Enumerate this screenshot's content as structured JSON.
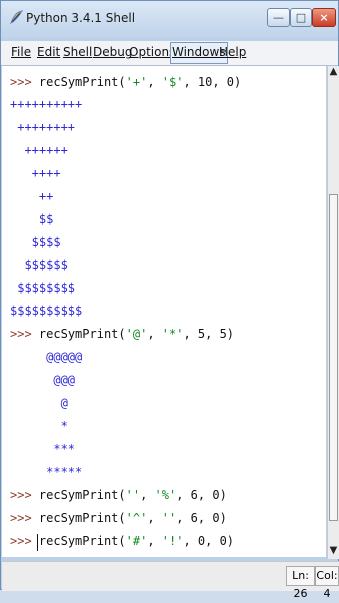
{
  "window": {
    "title": "Python 3.4.1 Shell",
    "buttons": {
      "minimize": "—",
      "maximize": "□",
      "close": "×"
    }
  },
  "menu": [
    "File",
    "Edit",
    "Shell",
    "Debug",
    "Options",
    "Windows",
    "Help"
  ],
  "shell": {
    "prompt": ">>>",
    "lines": [
      {
        "type": "command",
        "prompt": ">>>",
        "code": "recSymPrint('+', '$', 10, 0)"
      },
      {
        "type": "output",
        "text": "++++++++++"
      },
      {
        "type": "output",
        "text": " ++++++++"
      },
      {
        "type": "output",
        "text": "  ++++++"
      },
      {
        "type": "output",
        "text": "   ++++"
      },
      {
        "type": "output",
        "text": "    ++"
      },
      {
        "type": "output",
        "text": "    $$"
      },
      {
        "type": "output",
        "text": "   $$$$"
      },
      {
        "type": "output",
        "text": "  $$$$$$"
      },
      {
        "type": "output",
        "text": " $$$$$$$$"
      },
      {
        "type": "output",
        "text": "$$$$$$$$$$"
      },
      {
        "type": "command",
        "prompt": ">>>",
        "code": "recSymPrint('@', '*', 5, 5)"
      },
      {
        "type": "output",
        "text": "     @@@@@"
      },
      {
        "type": "output",
        "text": "      @@@"
      },
      {
        "type": "output",
        "text": "       @"
      },
      {
        "type": "output",
        "text": "       *"
      },
      {
        "type": "output",
        "text": "      ***"
      },
      {
        "type": "output",
        "text": "     *****"
      },
      {
        "type": "command",
        "prompt": ">>>",
        "code": "recSymPrint('', '%', 6, 0)"
      },
      {
        "type": "command",
        "prompt": ">>>",
        "code": "recSymPrint('^', '', 6, 0)"
      },
      {
        "type": "command",
        "prompt": ">>>",
        "code": "recSymPrint('#', '!', 0, 0)"
      },
      {
        "type": "prompt",
        "prompt": ">>>"
      }
    ]
  },
  "status": {
    "line": "Ln: 26",
    "col": "Col: 4"
  },
  "colors": {
    "prompt": "#8b3d28",
    "string": "#0f8a24",
    "output": "#2d27d6",
    "window": "#bcd0e8"
  },
  "icons": {
    "app": "python-feather-icon",
    "scroll_up": "up-arrow-icon",
    "scroll_down": "down-arrow-icon"
  }
}
